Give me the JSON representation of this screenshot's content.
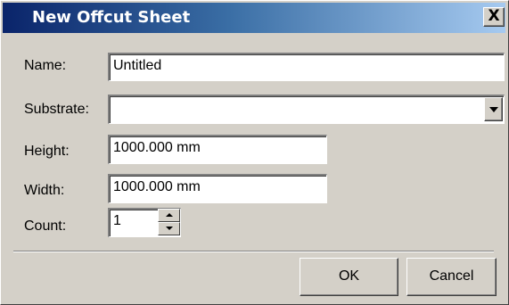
{
  "window": {
    "title": "New Offcut Sheet",
    "close_glyph": "X"
  },
  "form": {
    "name": {
      "label": "Name:",
      "value": "Untitled"
    },
    "substrate": {
      "label": "Substrate:",
      "value": ""
    },
    "height": {
      "label": "Height:",
      "value": "1000.000 mm"
    },
    "width": {
      "label": "Width:",
      "value": "1000.000 mm"
    },
    "count": {
      "label": "Count:",
      "value": "1"
    }
  },
  "buttons": {
    "ok": "OK",
    "cancel": "Cancel"
  },
  "colors": {
    "dialog_face": "#d4d0c8",
    "title_start": "#0a246a",
    "title_end": "#a6caf0"
  }
}
